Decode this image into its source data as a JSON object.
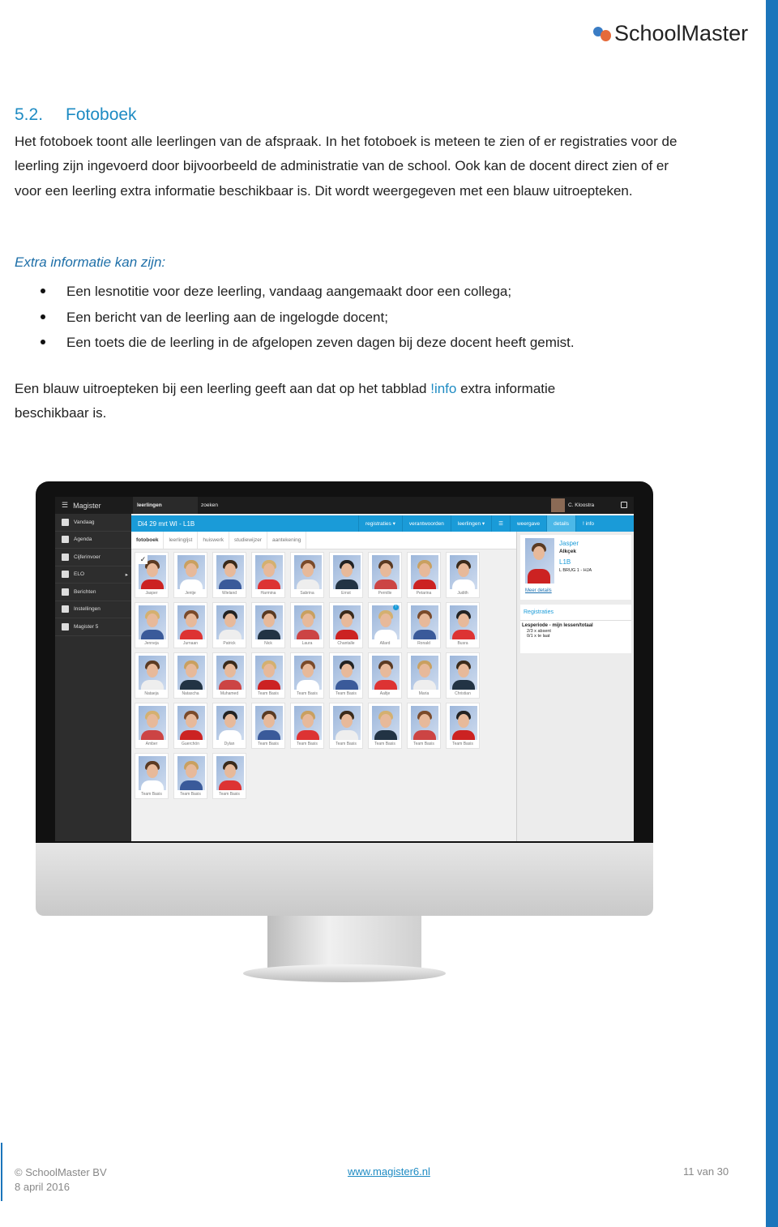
{
  "header": {
    "logo_text": "SchoolMaster"
  },
  "section": {
    "number": "5.2.",
    "title": "Fotoboek"
  },
  "intro": "Het fotoboek toont alle leerlingen van de afspraak. In het fotoboek is meteen te zien of er registraties voor de leerling zijn ingevoerd door bijvoorbeeld de administratie van de school. Ook kan de docent direct zien of er voor een leerling extra informatie beschikbaar is. Dit wordt weergegeven met een blauw uitroepteken.",
  "extra_heading": "Extra informatie kan zijn:",
  "bullets": [
    "Een lesnotitie voor deze leerling, vandaag aangemaakt door een collega;",
    "Een bericht van de leerling aan de ingelogde docent;",
    "Een toets die de leerling in de afgelopen zeven dagen bij deze docent heeft gemist."
  ],
  "closing": {
    "before": "Een blauw uitroepteken bij een leerling geeft aan dat op het tabblad ",
    "link": "!info",
    "after": " extra informatie beschikbaar is."
  },
  "app": {
    "brand": "Magister",
    "search_scope": "leerlingen",
    "search_placeholder": "zoeken",
    "user": "C. Kloostra",
    "sidebar": [
      "Vandaag",
      "Agenda",
      "Cijferinvoer",
      "ELO",
      "Berichten",
      "Instellingen",
      "Magister 5"
    ],
    "lesson_title": "Di4 29 mrt WI - L1B",
    "toolbar": [
      "registraties",
      "verantwoorden",
      "leerlingen"
    ],
    "panel_tabs": [
      "weergave",
      "details",
      "! info"
    ],
    "tabs": [
      "fotoboek",
      "leerlingljst",
      "huiswerk",
      "studiewijzer",
      "aantekening"
    ],
    "students": [
      [
        "Jasper",
        "Jentje",
        "Wieland",
        "Harmina",
        "Sabrina",
        "Ernst",
        "Pernille",
        "Petarina",
        "Judith"
      ],
      [
        "Jenneja",
        "Jurnaan",
        "Patrick",
        "Nick",
        "Laura",
        "Chantalle",
        "Allard",
        "Ronald",
        "Busra"
      ],
      [
        "Nataeja",
        "Natascha",
        "Muhamed",
        "Team Basis",
        "Team Basis",
        "Team Basis",
        "Aaltje",
        "Maria",
        "Christian"
      ],
      [
        "Amber",
        "Guerchön",
        "Dylan",
        "Team Basis",
        "Team Basis",
        "Team Basis",
        "Team Basis",
        "Team Basis",
        "Team Basis"
      ],
      [
        "Team Basis",
        "Team Basis",
        "Team Basis"
      ]
    ],
    "details": {
      "first_name": "Jasper",
      "last_name": "Alkçek",
      "class": "L1B",
      "group": "L BRUG 1 - HJA",
      "more": "Meer details"
    },
    "registrations": {
      "title": "Registraties",
      "heading": "Lesperiode - mijn lessen/totaal",
      "lines": [
        "2/3 x absent",
        "0/1 x te laat"
      ]
    },
    "accent": "#1a9bd8"
  },
  "footer": {
    "copyright": "© SchoolMaster BV",
    "date": "8 april 2016",
    "url": "www.magister6.nl",
    "page": "11 van 30"
  }
}
